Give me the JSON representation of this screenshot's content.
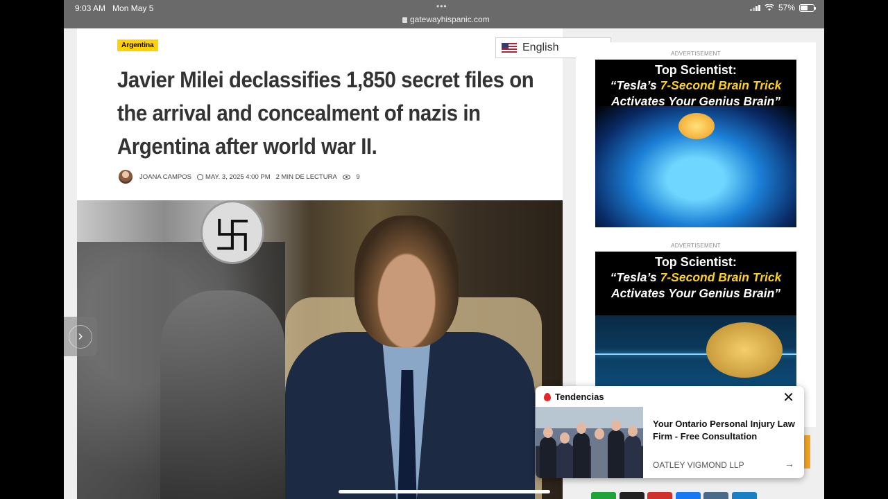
{
  "status_bar": {
    "time": "9:03 AM",
    "date": "Mon May 5",
    "dots": "•••",
    "url": "gatewayhispanic.com",
    "battery_text": "57%",
    "battery_level": 0.57
  },
  "article": {
    "category": "Argentina",
    "title": "Javier Milei declassifies 1,850 secret files on the arrival and concealment of nazis in Argentina after world war II.",
    "author": "JOANA CAMPOS",
    "date": "MAY. 3, 2025 4:00 PM",
    "read_time": "2 MIN DE LECTURA",
    "views": "9",
    "hero_flag_symbol": "卐"
  },
  "language_selector": {
    "value": "English",
    "flag": "us-flag-icon"
  },
  "sidebar": {
    "ads": [
      {
        "label": "ADVERTISEMENT",
        "headline": "Top Scientist:",
        "line1_prefix": "“Tesla’s ",
        "line1_highlight": "7-Second Brain Trick",
        "line2": "Activates Your Genius Brain”"
      },
      {
        "label": "ADVERTISEMENT",
        "headline": "Top Scientist:",
        "line1_prefix": "“Tesla’s ",
        "line1_highlight": "7-Second Brain Trick",
        "line2": "Activates Your Genius Brain”"
      }
    ]
  },
  "popup": {
    "title": "Tendencias",
    "close": "✕",
    "headline": "Your Ontario Personal Injury Law Firm - Free Consultation",
    "sponsor": "OATLEY VIGMOND LLP",
    "arrow": "→"
  },
  "nav": {
    "side_arrow": "›"
  },
  "colors": {
    "category_bg": "#ffd200",
    "ad_highlight": "#ffd21a",
    "fire_icon": "#e3262a",
    "status_bar": "#6a6a6a",
    "share_buttons": [
      "#1fa33a",
      "#222222",
      "#d0312d",
      "#1877f2",
      "#4a6a8a",
      "#1b7fc4"
    ]
  }
}
